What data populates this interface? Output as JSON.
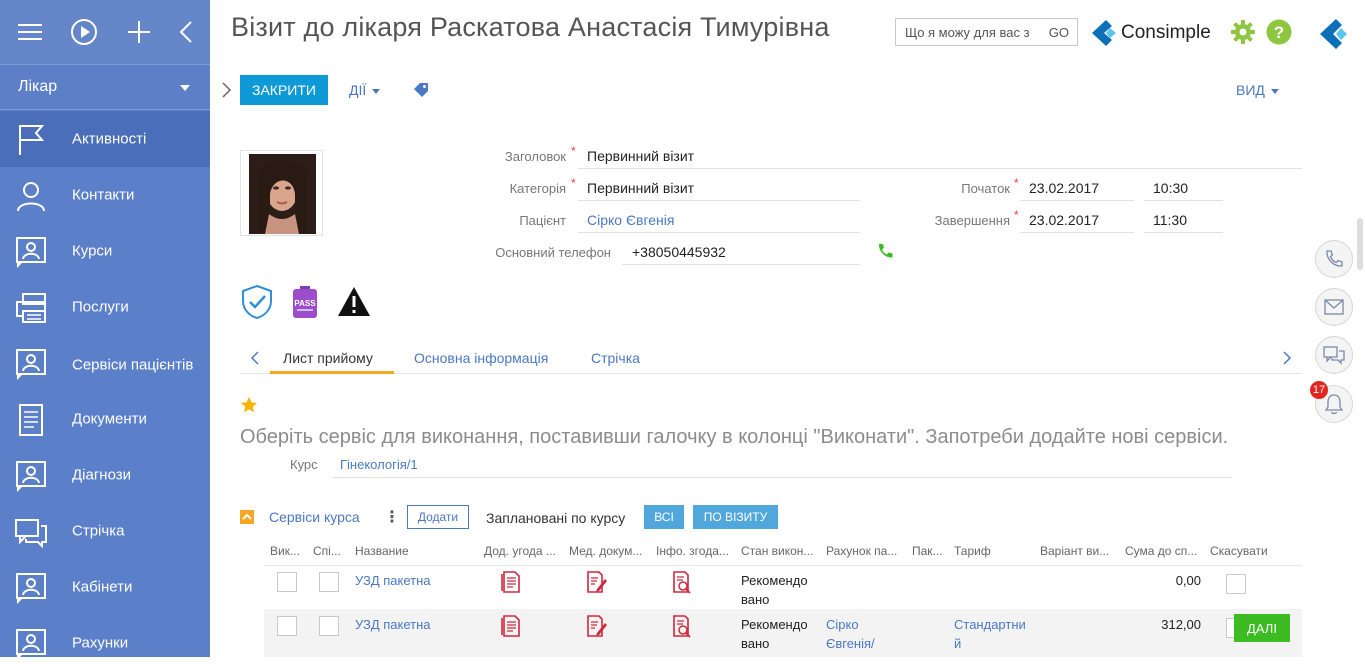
{
  "sidebar": {
    "workplace": "Лікар",
    "items": [
      {
        "label": "Активності",
        "icon": "flag-icon",
        "active": true
      },
      {
        "label": "Контакти",
        "icon": "person-icon"
      },
      {
        "label": "Курси",
        "icon": "contact-card-icon"
      },
      {
        "label": "Послуги",
        "icon": "printer-icon"
      },
      {
        "label": "Сервіси пацієнтів",
        "icon": "contact-card-icon"
      },
      {
        "label": "Документи",
        "icon": "document-icon"
      },
      {
        "label": "Діагнози",
        "icon": "contact-card-icon"
      },
      {
        "label": "Стрічка",
        "icon": "chat-icon"
      },
      {
        "label": "Кабінети",
        "icon": "contact-card-icon"
      },
      {
        "label": "Рахунки",
        "icon": "contact-card-icon"
      }
    ]
  },
  "header": {
    "title": "Візит до лікаря Раскатова Анастасія Тимурівна",
    "search_placeholder": "Що я можу для вас з",
    "search_go": "GO",
    "logo_text": "Consimple"
  },
  "toolbar": {
    "close_label": "ЗАКРИТИ",
    "actions_label": "ДІЇ",
    "view_label": "ВИД"
  },
  "form": {
    "title_label": "Заголовок",
    "title_value": "Первинний візит",
    "category_label": "Категорія",
    "category_value": "Первинний візит",
    "patient_label": "Пацієнт",
    "patient_value": "Сірко Євгенія",
    "phone_label": "Основний телефон",
    "phone_value": "+38050445932",
    "start_label": "Початок",
    "start_date": "23.02.2017",
    "start_time": "10:30",
    "end_label": "Завершення",
    "end_date": "23.02.2017",
    "end_time": "11:30",
    "pass_badge_text": "PASS"
  },
  "tabs": [
    "Лист прийому",
    "Основна інформація",
    "Стрічка"
  ],
  "hint": "Оберіть сервіс для виконання, поставивши галочку в колонці \"Виконати\". Запотреби додайте нові сервіси.",
  "course": {
    "label": "Курс",
    "value": "Гінекологія/1"
  },
  "detail": {
    "title": "Сервіси курса",
    "more": "⋮",
    "add_label": "Додати",
    "filter_label": "Заплановані по курсу",
    "filter_all": "ВСІ",
    "filter_visit": "ПО ВІЗИТУ",
    "columns": [
      "Вик...",
      "Спі...",
      "Название",
      "Дод. угода ...",
      "Мед. докум...",
      "Інфо. згода...",
      "Стан викон...",
      "Рахунок па...",
      "Пак...",
      "Тариф",
      "Варіант ви...",
      "Сума до сп...",
      "Скасувати"
    ],
    "rows": [
      {
        "name": "УЗД пакетна",
        "state_1": "Рекомендо",
        "state_2": "вано",
        "invoice_1": "",
        "invoice_2": "",
        "tariff_1": "",
        "tariff_2": "",
        "sum": "0,00"
      },
      {
        "name": "УЗД пакетна",
        "state_1": "Рекомендо",
        "state_2": "вано",
        "invoice_1": "Сірко",
        "invoice_2": "Євгенія/",
        "tariff_1": "Стандартни",
        "tariff_2": "й",
        "sum": "312,00"
      }
    ],
    "next_label": "ДАЛІ"
  },
  "right_panel": {
    "notifications_count": "17"
  },
  "colors": {
    "sidebar": "#5b7fc8",
    "sidebar_active": "#4a6eb9",
    "primary_button": "#0d9ad6",
    "link": "#4a78c2",
    "accent": "#f5a623",
    "success": "#3dbb22",
    "danger": "#e0261f"
  }
}
